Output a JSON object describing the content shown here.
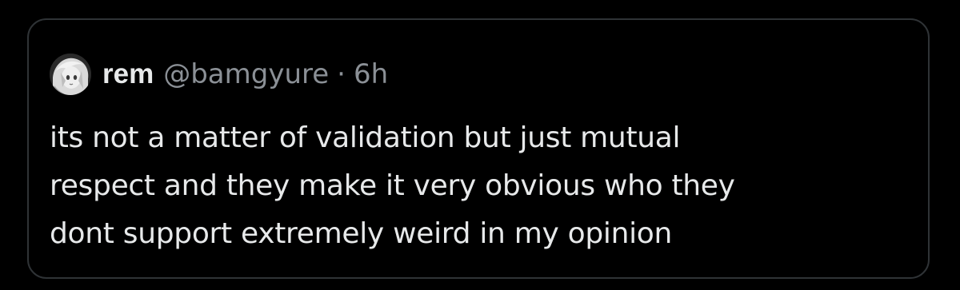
{
  "quoted_tweet": {
    "avatar_icon": "anime-avatar-icon",
    "display_name": "rem",
    "handle": "@bamgyure",
    "separator": "·",
    "timestamp": "6h",
    "text_lines": [
      "its not a matter of validation but just mutual",
      "respect and they make it very obvious who they",
      "dont support extremely weird in my opinion"
    ]
  },
  "colors": {
    "background": "#000000",
    "border": "#2f3336",
    "primary_text": "#e7e9ea",
    "secondary_text": "#8b9096"
  }
}
